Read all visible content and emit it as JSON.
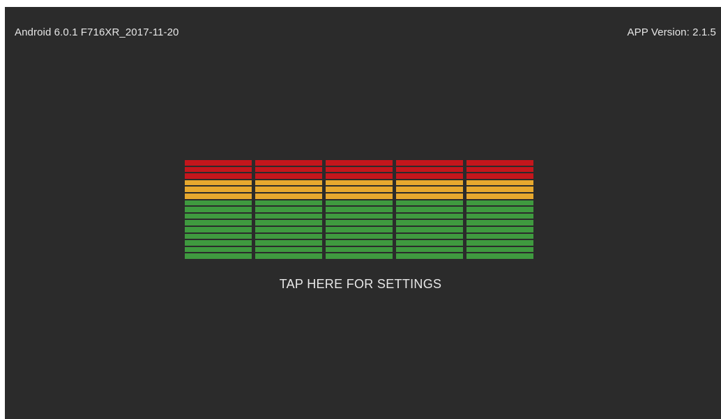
{
  "header": {
    "device_info": "Android 6.0.1 F716XR_2017-11-20",
    "app_version": "APP Version: 2.1.5"
  },
  "meter": {
    "columns": 5,
    "segment_colors": [
      "#c4161c",
      "#c4161c",
      "#c4161c",
      "#e6a82e",
      "#e6a82e",
      "#e6a82e",
      "#3f9a3f",
      "#3f9a3f",
      "#3f9a3f",
      "#3f9a3f",
      "#3f9a3f",
      "#3f9a3f",
      "#3f9a3f",
      "#3f9a3f",
      "#3f9a3f"
    ]
  },
  "action": {
    "settings_label": "TAP HERE FOR SETTINGS"
  },
  "colors": {
    "background": "#2b2b2b",
    "text": "#e6e6e6",
    "red": "#c4161c",
    "amber": "#e6a82e",
    "green": "#3f9a3f"
  }
}
